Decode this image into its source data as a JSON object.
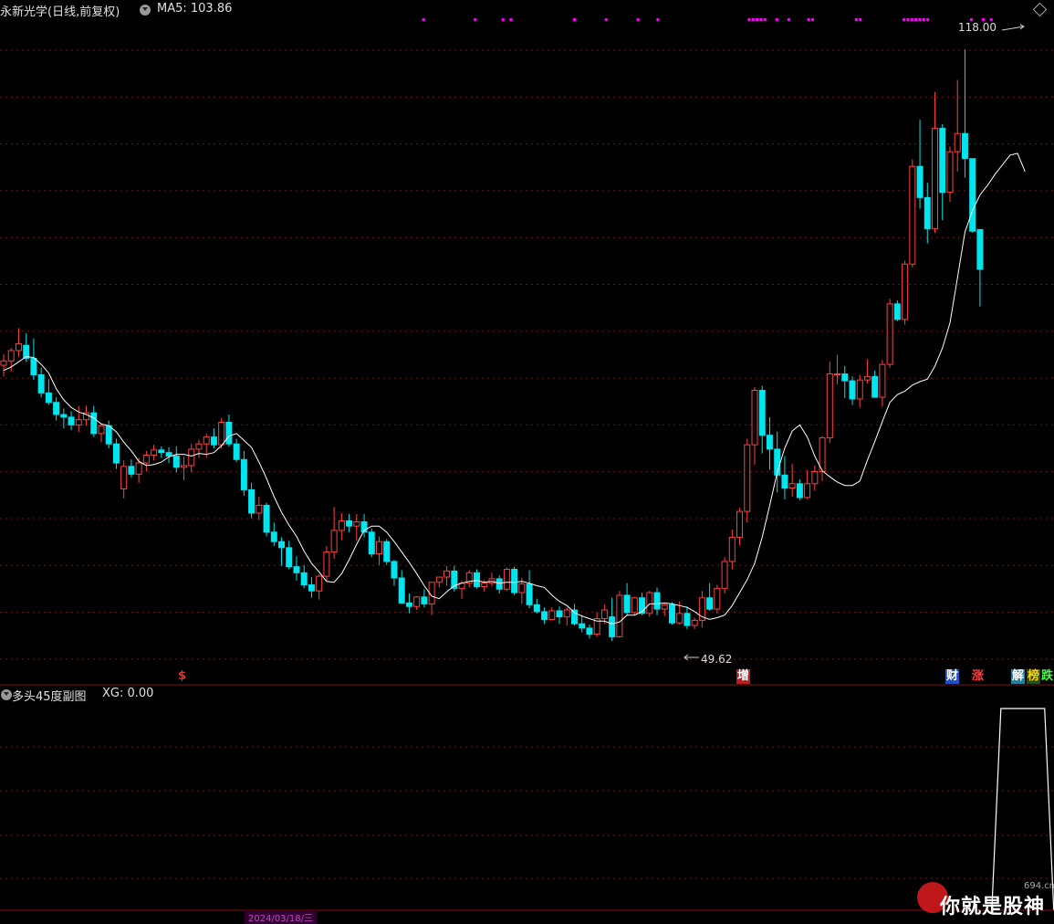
{
  "header": {
    "title": "永新光学(日线,前复权)",
    "ma_label": "MA5: 103.86",
    "sub_title": "多头45度副图",
    "sub_value": "XG: 0.00"
  },
  "annotations": {
    "high_label": "118.00",
    "low_label": "49.62"
  },
  "event_tags": [
    {
      "text": "$",
      "color": "#e03030",
      "bg": "#000000"
    },
    {
      "text": "增",
      "color": "#ffffff",
      "bg": "#b02020"
    },
    {
      "text": "财",
      "color": "#ffffff",
      "bg": "#2050c0"
    },
    {
      "text": "涨",
      "color": "#ff4040",
      "bg": "#000000"
    },
    {
      "text": "解",
      "color": "#ffffff",
      "bg": "#2080a0"
    },
    {
      "text": "榜",
      "color": "#ffd000",
      "bg": "#205020"
    },
    {
      "text": "跌",
      "color": "#40ff40",
      "bg": "#000000"
    }
  ],
  "watermark": {
    "text": "你就是股神",
    "sub": "694.cn"
  },
  "date_hint": "2024/03/18/三",
  "colors": {
    "up": "#ff4040",
    "down": "#00e5ee",
    "ma": "#ffffff",
    "grid": "#7a1010",
    "signal": "#ff00ff"
  },
  "chart_data": {
    "type": "candlestick",
    "title": "永新光学(日线,前复权)",
    "ylim": [
      47.5,
      121
    ],
    "ma_period": 5,
    "candles": [
      [
        81.5,
        82.8,
        80.2,
        82.0
      ],
      [
        82.0,
        83.5,
        80.8,
        83.2
      ],
      [
        83.2,
        85.8,
        82.5,
        84.0
      ],
      [
        83.8,
        85.2,
        81.9,
        82.3
      ],
      [
        82.3,
        84.6,
        79.8,
        80.4
      ],
      [
        80.4,
        81.2,
        77.8,
        78.3
      ],
      [
        78.3,
        79.9,
        76.9,
        77.2
      ],
      [
        77.2,
        77.8,
        75.1,
        75.8
      ],
      [
        75.8,
        76.5,
        74.2,
        75.5
      ],
      [
        75.5,
        76.2,
        74.0,
        74.6
      ],
      [
        74.6,
        76.8,
        73.8,
        75.2
      ],
      [
        75.2,
        76.8,
        74.5,
        76.0
      ],
      [
        76.0,
        76.8,
        73.2,
        73.6
      ],
      [
        73.6,
        74.8,
        72.6,
        74.5
      ],
      [
        74.5,
        75.1,
        71.9,
        72.4
      ],
      [
        72.4,
        73.0,
        69.5,
        70.2
      ],
      [
        67.2,
        70.5,
        66.1,
        69.8
      ],
      [
        69.8,
        70.6,
        68.5,
        68.9
      ],
      [
        68.9,
        70.8,
        67.9,
        70.2
      ],
      [
        70.2,
        71.6,
        69.2,
        71.1
      ],
      [
        71.1,
        72.3,
        70.5,
        71.7
      ],
      [
        71.7,
        72.1,
        70.8,
        71.4
      ],
      [
        71.4,
        72.0,
        70.2,
        71.0
      ],
      [
        71.0,
        72.1,
        69.1,
        69.7
      ],
      [
        69.7,
        70.9,
        68.2,
        69.9
      ],
      [
        69.9,
        72.4,
        69.1,
        71.8
      ],
      [
        71.8,
        72.9,
        70.8,
        72.4
      ],
      [
        72.4,
        73.6,
        70.8,
        73.2
      ],
      [
        73.2,
        74.2,
        71.9,
        72.3
      ],
      [
        72.3,
        75.4,
        71.9,
        74.9
      ],
      [
        74.9,
        75.8,
        72.1,
        72.4
      ],
      [
        72.4,
        73.0,
        70.3,
        70.6
      ],
      [
        70.6,
        71.6,
        66.4,
        67.1
      ],
      [
        67.1,
        67.9,
        63.8,
        64.4
      ],
      [
        64.4,
        66.3,
        63.6,
        65.3
      ],
      [
        65.3,
        65.6,
        61.7,
        62.2
      ],
      [
        62.2,
        63.3,
        60.6,
        61.1
      ],
      [
        61.1,
        61.6,
        58.3,
        60.4
      ],
      [
        60.4,
        61.2,
        57.9,
        58.2
      ],
      [
        58.2,
        59.4,
        56.6,
        57.5
      ],
      [
        57.5,
        58.4,
        55.7,
        56.1
      ],
      [
        56.1,
        57.0,
        54.6,
        55.4
      ],
      [
        55.4,
        57.3,
        54.4,
        57.1
      ],
      [
        57.1,
        60.6,
        56.6,
        59.9
      ],
      [
        59.9,
        65.1,
        59.1,
        62.4
      ],
      [
        62.4,
        64.4,
        61.3,
        63.5
      ],
      [
        63.5,
        64.3,
        62.2,
        62.9
      ],
      [
        62.9,
        64.3,
        61.2,
        63.4
      ],
      [
        63.4,
        64.3,
        61.6,
        62.2
      ],
      [
        62.2,
        62.6,
        59.3,
        59.7
      ],
      [
        59.7,
        61.7,
        58.4,
        61.1
      ],
      [
        61.1,
        61.4,
        58.4,
        58.8
      ],
      [
        58.8,
        59.0,
        56.0,
        56.9
      ],
      [
        56.9,
        57.8,
        53.9,
        54.0
      ],
      [
        54.0,
        55.1,
        52.8,
        53.6
      ],
      [
        53.6,
        54.8,
        53.2,
        54.7
      ],
      [
        54.7,
        55.6,
        53.5,
        53.9
      ],
      [
        53.9,
        56.3,
        52.6,
        56.4
      ],
      [
        56.4,
        57.0,
        55.8,
        57.0
      ],
      [
        57.0,
        58.3,
        56.0,
        57.7
      ],
      [
        57.7,
        58.3,
        55.3,
        55.7
      ],
      [
        55.7,
        56.6,
        54.5,
        56.3
      ],
      [
        56.3,
        57.8,
        55.8,
        57.5
      ],
      [
        57.5,
        57.9,
        55.7,
        55.9
      ],
      [
        55.9,
        56.7,
        55.3,
        56.3
      ],
      [
        56.3,
        57.5,
        55.9,
        56.8
      ],
      [
        56.8,
        57.2,
        55.1,
        55.6
      ],
      [
        55.6,
        58.1,
        55.4,
        57.9
      ],
      [
        57.9,
        58.2,
        54.9,
        55.2
      ],
      [
        55.2,
        56.9,
        53.9,
        56.2
      ],
      [
        56.2,
        57.8,
        53.4,
        53.8
      ],
      [
        53.8,
        54.5,
        52.8,
        53.0
      ],
      [
        53.0,
        53.5,
        51.6,
        52.1
      ],
      [
        52.1,
        53.5,
        52.0,
        53.1
      ],
      [
        53.1,
        53.6,
        51.6,
        52.4
      ],
      [
        52.4,
        53.5,
        51.4,
        53.2
      ],
      [
        53.2,
        53.9,
        51.4,
        51.6
      ],
      [
        51.6,
        52.6,
        50.6,
        51.1
      ],
      [
        51.1,
        51.5,
        49.9,
        50.4
      ],
      [
        50.4,
        52.9,
        50.1,
        52.2
      ],
      [
        52.2,
        53.8,
        51.6,
        53.2
      ],
      [
        52.4,
        54.6,
        49.6,
        50.1
      ],
      [
        50.1,
        55.4,
        50.0,
        54.9
      ],
      [
        54.9,
        56.3,
        52.6,
        52.9
      ],
      [
        52.9,
        54.7,
        52.6,
        54.6
      ],
      [
        54.6,
        55.2,
        52.6,
        52.8
      ],
      [
        52.8,
        55.4,
        52.4,
        55.2
      ],
      [
        55.2,
        55.8,
        52.6,
        53.3
      ],
      [
        53.3,
        54.0,
        52.5,
        53.8
      ],
      [
        53.8,
        54.1,
        51.5,
        51.7
      ],
      [
        51.7,
        54.2,
        51.5,
        52.8
      ],
      [
        52.8,
        53.6,
        51.0,
        51.4
      ],
      [
        51.4,
        52.3,
        51.0,
        52.0
      ],
      [
        52.0,
        55.4,
        51.2,
        54.6
      ],
      [
        54.6,
        56.3,
        53.1,
        53.3
      ],
      [
        53.3,
        56.1,
        52.8,
        55.7
      ],
      [
        55.7,
        59.3,
        55.1,
        58.8
      ],
      [
        58.8,
        62.5,
        57.9,
        61.6
      ],
      [
        61.6,
        65.0,
        60.7,
        64.6
      ],
      [
        64.6,
        73.0,
        63.3,
        72.3
      ],
      [
        72.3,
        79.0,
        70.0,
        78.6
      ],
      [
        78.6,
        79.1,
        71.3,
        73.4
      ],
      [
        73.4,
        75.5,
        69.4,
        71.8
      ],
      [
        71.8,
        73.8,
        66.8,
        68.8
      ],
      [
        68.8,
        71.0,
        66.0,
        67.3
      ],
      [
        67.3,
        70.1,
        66.3,
        67.8
      ],
      [
        67.8,
        68.3,
        65.9,
        66.2
      ],
      [
        66.2,
        69.4,
        66.0,
        67.8
      ],
      [
        67.8,
        69.9,
        67.0,
        69.2
      ],
      [
        69.2,
        73.3,
        68.1,
        73.1
      ],
      [
        73.1,
        81.9,
        72.5,
        80.5
      ],
      [
        80.5,
        82.7,
        79.3,
        80.5
      ],
      [
        80.5,
        81.4,
        77.7,
        79.7
      ],
      [
        79.7,
        80.2,
        76.9,
        77.6
      ],
      [
        77.6,
        80.4,
        76.6,
        79.8
      ],
      [
        79.8,
        82.2,
        79.4,
        80.2
      ],
      [
        80.2,
        80.9,
        77.8,
        77.8
      ],
      [
        77.8,
        82.1,
        76.7,
        81.6
      ],
      [
        81.6,
        89.2,
        81.2,
        88.6
      ],
      [
        88.6,
        89.0,
        86.6,
        86.8
      ],
      [
        86.8,
        93.6,
        86.2,
        93.2
      ],
      [
        93.2,
        105.3,
        92.8,
        104.5
      ],
      [
        104.5,
        109.9,
        99.6,
        100.9
      ],
      [
        100.9,
        102.6,
        95.6,
        97.3
      ],
      [
        97.3,
        113.1,
        96.8,
        108.9
      ],
      [
        108.9,
        109.4,
        98.3,
        101.5
      ],
      [
        101.5,
        106.8,
        100.4,
        106.2
      ],
      [
        106.2,
        114.5,
        103.9,
        108.3
      ],
      [
        108.3,
        118.0,
        103.2,
        105.4
      ],
      [
        105.4,
        105.4,
        96.8,
        97.0
      ],
      [
        97.2,
        97.2,
        88.3,
        92.6
      ]
    ],
    "ma5": [
      80.9,
      81.3,
      81.9,
      82.5,
      82.4,
      81.6,
      80.6,
      78.8,
      77.5,
      76.6,
      76.1,
      75.8,
      75.4,
      74.7,
      74.5,
      73.8,
      72.6,
      71.6,
      70.4,
      69.9,
      70.0,
      70.3,
      70.9,
      71.2,
      71.2,
      71.0,
      71.3,
      71.2,
      71.4,
      72.2,
      73.3,
      73.6,
      72.8,
      72.0,
      70.3,
      68.4,
      66.3,
      64.5,
      63.0,
      61.7,
      60.0,
      58.6,
      57.6,
      56.5,
      56.4,
      57.4,
      59.0,
      60.8,
      62.4,
      62.9,
      62.9,
      62.2,
      61.1,
      59.9,
      58.7,
      57.4,
      56.0,
      54.8,
      54.5,
      55.3,
      56.0,
      56.3,
      56.5,
      56.6,
      56.4,
      56.5,
      56.3,
      56.4,
      56.4,
      56.5,
      56.3,
      56.0,
      55.8,
      54.9,
      54.2,
      53.7,
      52.9,
      52.5,
      52.2,
      51.9,
      51.9,
      51.6,
      51.8,
      52.6,
      52.6,
      53.0,
      53.9,
      53.9,
      54.0,
      53.9,
      53.7,
      53.5,
      53.0,
      52.4,
      52.1,
      52.3,
      52.6,
      53.7,
      55.2,
      56.7,
      58.6,
      61.6,
      65.3,
      69.1,
      71.9,
      73.9,
      74.6,
      73.2,
      71.0,
      69.3,
      68.6,
      68.0,
      67.6,
      67.6,
      68.1,
      70.5,
      72.7,
      75.0,
      77.2,
      78.1,
      78.5,
      79.2,
      79.6,
      79.9,
      81.4,
      83.5,
      86.4,
      91.6,
      96.9,
      99.4,
      101.2,
      102.3,
      103.6,
      104.7,
      105.8,
      106.0,
      103.9
    ],
    "signal_days": [
      42,
      55,
      62,
      64,
      80,
      88,
      96,
      101,
      124,
      125,
      126,
      127,
      128,
      131,
      134,
      139,
      140,
      151,
      152,
      163,
      164,
      165,
      166,
      167,
      168,
      169,
      180,
      183,
      185,
      194,
      195,
      196,
      197,
      198
    ],
    "sub_xg_range": [
      134,
      138
    ],
    "high": {
      "value": 118.0,
      "index": 129
    },
    "low": {
      "value": 49.62,
      "index": 82
    }
  }
}
